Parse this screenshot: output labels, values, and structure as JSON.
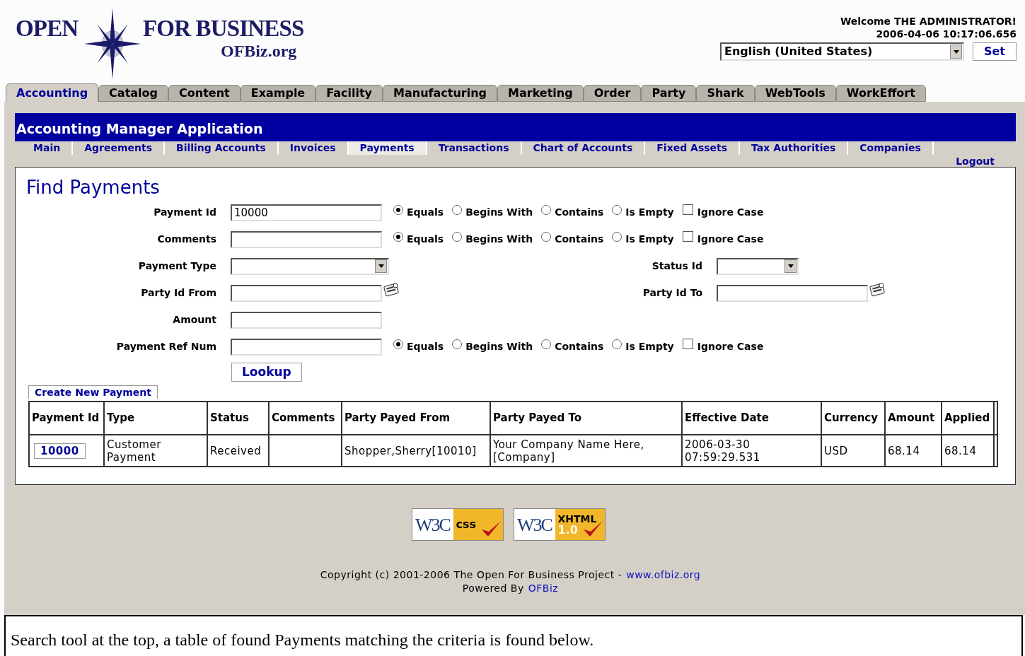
{
  "logo": {
    "name": "OPEN FOR BUSINESS",
    "site": "OFBiz.org"
  },
  "header": {
    "welcome": "Welcome THE ADMINISTRATOR!",
    "timestamp": "2006-04-06 10:17:06.656",
    "locale": {
      "value": "English (United States)"
    },
    "set_button": "Set"
  },
  "app_tabs": [
    {
      "label": "Accounting",
      "selected": true
    },
    {
      "label": "Catalog",
      "selected": false
    },
    {
      "label": "Content",
      "selected": false
    },
    {
      "label": "Example",
      "selected": false
    },
    {
      "label": "Facility",
      "selected": false
    },
    {
      "label": "Manufacturing",
      "selected": false
    },
    {
      "label": "Marketing",
      "selected": false
    },
    {
      "label": "Order",
      "selected": false
    },
    {
      "label": "Party",
      "selected": false
    },
    {
      "label": "Shark",
      "selected": false
    },
    {
      "label": "WebTools",
      "selected": false
    },
    {
      "label": "WorkEffort",
      "selected": false
    }
  ],
  "app_title": "Accounting Manager Application",
  "sub_tabs": [
    {
      "label": "Main",
      "selected": false
    },
    {
      "label": "Agreements",
      "selected": false
    },
    {
      "label": "Billing Accounts",
      "selected": false
    },
    {
      "label": "Invoices",
      "selected": false
    },
    {
      "label": "Payments",
      "selected": true
    },
    {
      "label": "Transactions",
      "selected": false
    },
    {
      "label": "Chart of Accounts",
      "selected": false
    },
    {
      "label": "Fixed Assets",
      "selected": false
    },
    {
      "label": "Tax Authorities",
      "selected": false
    },
    {
      "label": "Companies",
      "selected": false
    }
  ],
  "logout": "Logout",
  "form": {
    "title": "Find Payments",
    "rows": [
      {
        "fields": [
          {
            "kind": "text",
            "label": "Payment Id",
            "value": "10000",
            "operators": [
              {
                "label": "Equals",
                "selected": true
              },
              {
                "label": "Begins With",
                "selected": false
              },
              {
                "label": "Contains",
                "selected": false
              },
              {
                "label": "Is Empty",
                "selected": false
              }
            ],
            "ignore_case": {
              "label": "Ignore Case",
              "checked": false
            }
          }
        ]
      },
      {
        "fields": [
          {
            "kind": "text",
            "label": "Comments",
            "operators": [
              {
                "label": "Equals",
                "selected": true
              },
              {
                "label": "Begins With",
                "selected": false
              },
              {
                "label": "Contains",
                "selected": false
              },
              {
                "label": "Is Empty",
                "selected": false
              }
            ],
            "ignore_case": {
              "label": "Ignore Case",
              "checked": false
            }
          }
        ]
      },
      {
        "fields": [
          {
            "kind": "select",
            "label": "Payment Type"
          },
          {
            "kind": "select",
            "label": "Status Id"
          }
        ]
      },
      {
        "fields": [
          {
            "kind": "lookup",
            "label": "Party Id From"
          },
          {
            "kind": "lookup",
            "label": "Party Id To"
          }
        ]
      },
      {
        "fields": [
          {
            "kind": "text",
            "label": "Amount"
          }
        ]
      },
      {
        "fields": [
          {
            "kind": "text",
            "label": "Payment Ref Num",
            "operators": [
              {
                "label": "Equals",
                "selected": true
              },
              {
                "label": "Begins With",
                "selected": false
              },
              {
                "label": "Contains",
                "selected": false
              },
              {
                "label": "Is Empty",
                "selected": false
              }
            ],
            "ignore_case": {
              "label": "Ignore Case",
              "checked": false
            }
          }
        ]
      }
    ],
    "submit": "Lookup"
  },
  "create_link": "Create New Payment",
  "table": {
    "columns": [
      "Payment Id",
      "Type",
      "Status",
      "Comments",
      "Party Payed From",
      "Party Payed To",
      "Effective Date",
      "Currency",
      "Amount",
      "Applied"
    ],
    "rows": [
      [
        "10000",
        "Customer Payment",
        "Received",
        "",
        "Shopper,Sherry[10010]",
        "Your Company Name Here,[Company]",
        "2006-03-30 07:59:29.531",
        "USD",
        "68.14",
        "68.14"
      ]
    ]
  },
  "badges": [
    {
      "logo": "W3C",
      "label": "css"
    },
    {
      "logo": "W3C",
      "label": "XHTML",
      "version": "1.0"
    }
  ],
  "footer": {
    "copyright": "Copyright (c) 2001-2006 The Open For Business Project -",
    "copyright_link": "www.ofbiz.org",
    "powered_by": "Powered By",
    "powered_link": "OFBiz"
  },
  "caption": "Search tool at the top, a table of found Payments matching the criteria is found below."
}
